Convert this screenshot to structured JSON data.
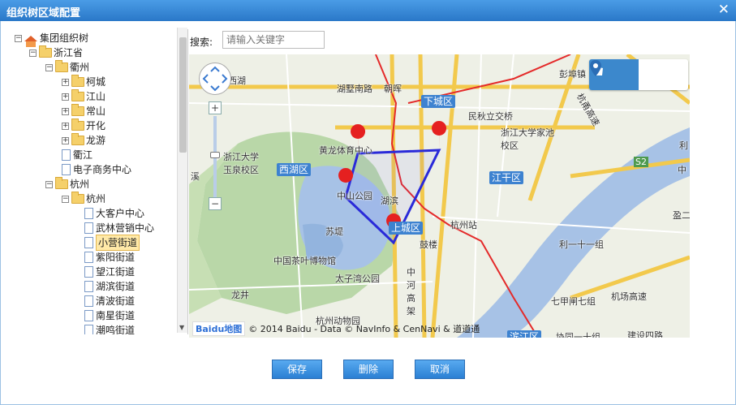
{
  "dialog": {
    "title": "组织树区域配置"
  },
  "tree": {
    "items": [
      {
        "label": "集团组织树",
        "icon": "home-icon",
        "level": 0,
        "toggle": "−"
      },
      {
        "label": "浙江省",
        "icon": "folder-icon",
        "level": 1,
        "toggle": "−"
      },
      {
        "label": "衢州",
        "icon": "folder-icon",
        "level": 2,
        "toggle": "−"
      },
      {
        "label": "柯城",
        "icon": "folder-icon",
        "level": 3,
        "toggle": "+"
      },
      {
        "label": "江山",
        "icon": "folder-icon",
        "level": 3,
        "toggle": "+"
      },
      {
        "label": "常山",
        "icon": "folder-icon",
        "level": 3,
        "toggle": "+"
      },
      {
        "label": "开化",
        "icon": "folder-icon",
        "level": 3,
        "toggle": "+"
      },
      {
        "label": "龙游",
        "icon": "folder-icon",
        "level": 3,
        "toggle": "+"
      },
      {
        "label": "衢江",
        "icon": "file-icon",
        "level": 3,
        "toggle": ""
      },
      {
        "label": "电子商务中心",
        "icon": "file-icon",
        "level": 3,
        "toggle": ""
      },
      {
        "label": "杭州",
        "icon": "folder-icon",
        "level": 2,
        "toggle": "−"
      },
      {
        "label": "杭州",
        "icon": "folder-icon",
        "level": 3,
        "toggle": "−"
      },
      {
        "label": "大客户中心",
        "icon": "file-icon",
        "level": 4,
        "toggle": ""
      },
      {
        "label": "武林营销中心",
        "icon": "file-icon",
        "level": 4,
        "toggle": ""
      },
      {
        "label": "小营街道",
        "icon": "file-icon",
        "level": 4,
        "toggle": "",
        "selected": true
      },
      {
        "label": "紫阳街道",
        "icon": "file-icon",
        "level": 4,
        "toggle": ""
      },
      {
        "label": "望江街道",
        "icon": "file-icon",
        "level": 4,
        "toggle": ""
      },
      {
        "label": "湖滨街道",
        "icon": "file-icon",
        "level": 4,
        "toggle": ""
      },
      {
        "label": "清波街道",
        "icon": "file-icon",
        "level": 4,
        "toggle": ""
      },
      {
        "label": "南星街道",
        "icon": "file-icon",
        "level": 4,
        "toggle": ""
      },
      {
        "label": "潮鸣街道",
        "icon": "file-icon",
        "level": 4,
        "toggle": ""
      }
    ]
  },
  "search": {
    "label": "搜索:",
    "placeholder": "请输入关键字"
  },
  "map": {
    "labels": [
      "西湖",
      "湖墅南路",
      "朝晖",
      "彭埠镇",
      "民秋立交桥",
      "浙江大学家池校区",
      "黄龙体育中心",
      "浙江大学玉泉校区",
      "湖滨",
      "杭州站",
      "苏堤",
      "鼓楼",
      "中国茶叶博物馆",
      "太子湾公园",
      "利一十一组",
      "七甲闸七组",
      "机场高速",
      "龙井",
      "杭州动物园",
      "协同一十组",
      "建设四路",
      "盈二",
      "中河高架",
      "杭甬高速",
      "利",
      "中",
      "溪",
      "S2",
      "中山公园"
    ],
    "districts": [
      "下城区",
      "西湖区",
      "江干区",
      "上城区",
      "滨江区"
    ],
    "copyright": "© 2014 Baidu - Data © NavInfo & CenNavi & 道道通",
    "logo": {
      "bai": "Bai",
      "du": "du",
      "suffix": "地图"
    },
    "zoom_in": "+",
    "zoom_out": "−"
  },
  "buttons": {
    "save": "保存",
    "delete": "删除",
    "cancel": "取消"
  },
  "colors": {
    "accent": "#2b7fd3",
    "polygon": "#2a2ad9",
    "marker": "#e52020"
  }
}
